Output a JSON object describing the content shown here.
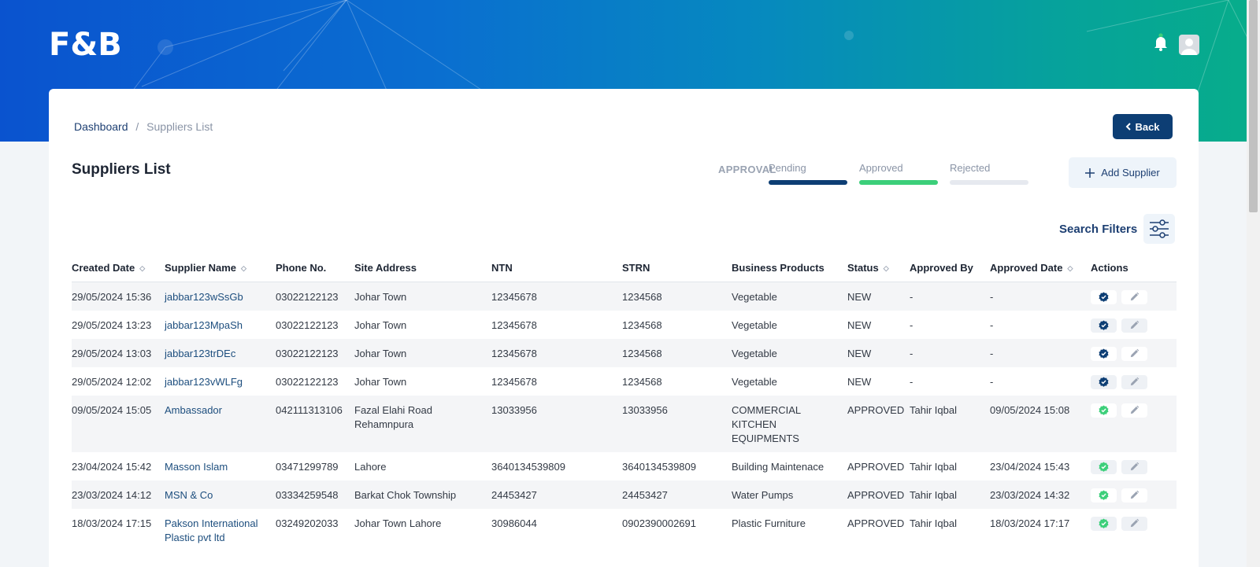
{
  "header": {
    "logo": "F&B",
    "icons": [
      "bell-icon",
      "user-avatar"
    ]
  },
  "breadcrumb": {
    "home": "Dashboard",
    "separator": "/",
    "current": "Suppliers List"
  },
  "back_button": "Back",
  "page_title": "Suppliers List",
  "approval": {
    "label": "APPROVAL",
    "tabs": [
      {
        "label": "Pending",
        "color": "#0d3e74"
      },
      {
        "label": "Approved",
        "color": "#3ccf7a"
      },
      {
        "label": "Rejected",
        "color": "#e6e9ef"
      }
    ]
  },
  "add_supplier": "Add Supplier",
  "search_filters": "Search Filters",
  "table": {
    "headers": [
      "Created Date",
      "Supplier Name",
      "Phone No.",
      "Site Address",
      "NTN",
      "STRN",
      "Business Products",
      "Status",
      "Approved By",
      "Approved Date",
      "Actions"
    ],
    "rows": [
      {
        "created": "29/05/2024 15:36",
        "name": "jabbar123wSsGb",
        "phone": "03022122123",
        "address": "Johar Town",
        "ntn": "12345678",
        "strn": "1234568",
        "products": "Vegetable",
        "status": "NEW",
        "approved_by": "-",
        "approved_date": "-"
      },
      {
        "created": "29/05/2024 13:23",
        "name": "jabbar123MpaSh",
        "phone": "03022122123",
        "address": "Johar Town",
        "ntn": "12345678",
        "strn": "1234568",
        "products": "Vegetable",
        "status": "NEW",
        "approved_by": "-",
        "approved_date": "-"
      },
      {
        "created": "29/05/2024 13:03",
        "name": "jabbar123trDEc",
        "phone": "03022122123",
        "address": "Johar Town",
        "ntn": "12345678",
        "strn": "1234568",
        "products": "Vegetable",
        "status": "NEW",
        "approved_by": "-",
        "approved_date": "-"
      },
      {
        "created": "29/05/2024 12:02",
        "name": "jabbar123vWLFg",
        "phone": "03022122123",
        "address": "Johar Town",
        "ntn": "12345678",
        "strn": "1234568",
        "products": "Vegetable",
        "status": "NEW",
        "approved_by": "-",
        "approved_date": "-"
      },
      {
        "created": "09/05/2024 15:05",
        "name": "Ambassador",
        "phone": "042111313106",
        "address": "Fazal Elahi Road Rehamnpura",
        "ntn": "13033956",
        "strn": "13033956",
        "products": "COMMERCIAL KITCHEN EQUIPMENTS",
        "status": "APPROVED",
        "approved_by": "Tahir Iqbal",
        "approved_date": "09/05/2024 15:08"
      },
      {
        "created": "23/04/2024 15:42",
        "name": "Masson Islam",
        "phone": "03471299789",
        "address": "Lahore",
        "ntn": "3640134539809",
        "strn": "3640134539809",
        "products": "Building Maintenace",
        "status": "APPROVED",
        "approved_by": "Tahir Iqbal",
        "approved_date": "23/04/2024 15:43"
      },
      {
        "created": "23/03/2024 14:12",
        "name": "MSN & Co",
        "phone": "03334259548",
        "address": "Barkat Chok Township",
        "ntn": "24453427",
        "strn": "24453427",
        "products": "Water Pumps",
        "status": "APPROVED",
        "approved_by": "Tahir Iqbal",
        "approved_date": "23/03/2024 14:32"
      },
      {
        "created": "18/03/2024 17:15",
        "name": "Pakson International Plastic pvt ltd",
        "phone": "03249202033",
        "address": "Johar Town Lahore",
        "ntn": "30986044",
        "strn": "0902390002691",
        "products": "Plastic Furniture",
        "status": "APPROVED",
        "approved_by": "Tahir Iqbal",
        "approved_date": "18/03/2024 17:17"
      }
    ]
  },
  "colors": {
    "primary": "#0d3e74",
    "approved_check": "#3ccf7a",
    "new_check": "#0d3e74"
  }
}
